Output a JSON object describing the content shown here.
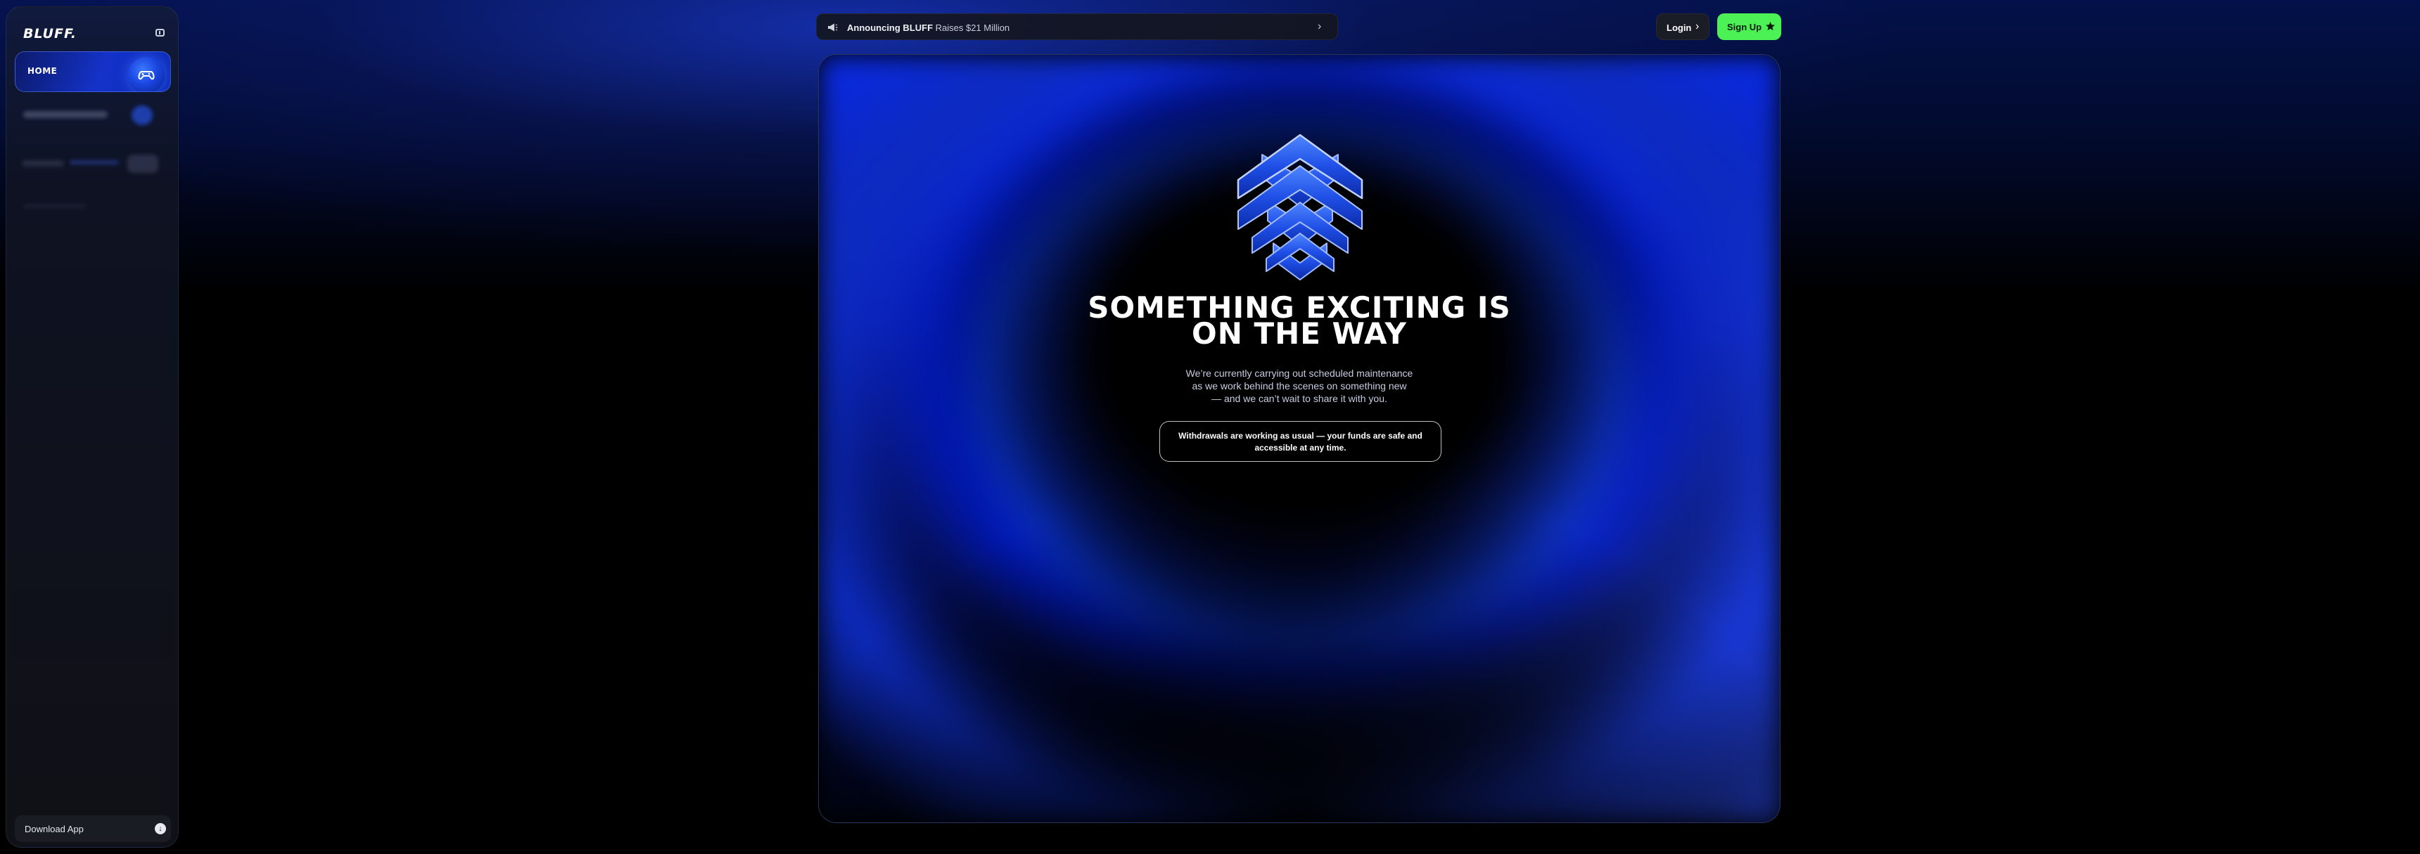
{
  "sidebar": {
    "logo": "BLUFF.",
    "nav": [
      {
        "label": "HOME",
        "active": true,
        "icon": "gamepad-icon"
      }
    ],
    "download_label": "Download App",
    "download_icon": "download-icon"
  },
  "header": {
    "announcement": {
      "prefix": "Announcing BLUFF",
      "suffix": "Raises $21 Million"
    },
    "login_label": "Login",
    "signup_label": "Sign Up"
  },
  "hero": {
    "title_line1": "SOMETHING EXCITING IS",
    "title_line2": "ON THE WAY",
    "description": [
      "We’re currently carrying out scheduled maintenance",
      "as we work behind the scenes on something new",
      "— and we can’t wait to share it with you."
    ],
    "notice": [
      "Withdrawals are working as usual — your funds are safe and",
      "accessible at any time."
    ]
  },
  "colors": {
    "accent_blue": "#1432c8",
    "signup_green": "#4cf255",
    "background": "#000000"
  }
}
